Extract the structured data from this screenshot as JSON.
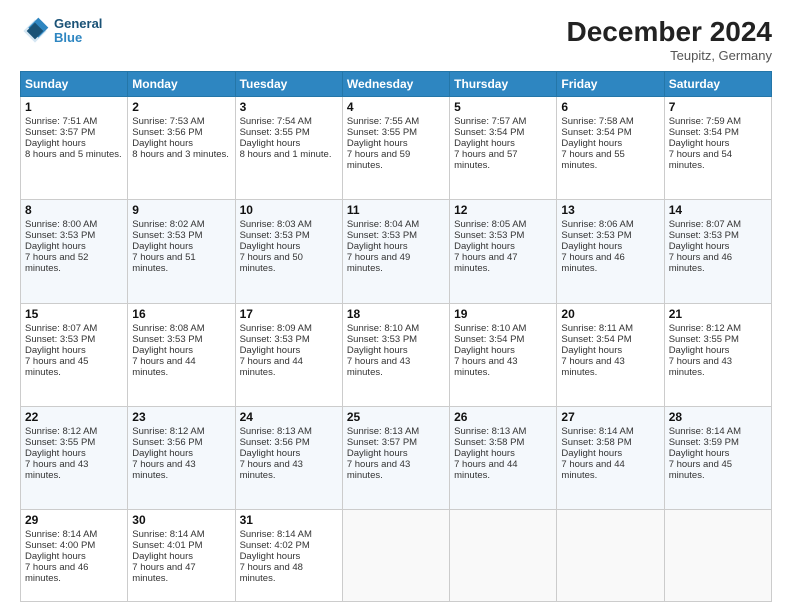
{
  "header": {
    "logo_line1": "General",
    "logo_line2": "Blue",
    "month": "December 2024",
    "location": "Teupitz, Germany"
  },
  "days_of_week": [
    "Sunday",
    "Monday",
    "Tuesday",
    "Wednesday",
    "Thursday",
    "Friday",
    "Saturday"
  ],
  "weeks": [
    [
      {
        "day": "1",
        "sunrise": "7:51 AM",
        "sunset": "3:57 PM",
        "daylight": "8 hours and 5 minutes."
      },
      {
        "day": "2",
        "sunrise": "7:53 AM",
        "sunset": "3:56 PM",
        "daylight": "8 hours and 3 minutes."
      },
      {
        "day": "3",
        "sunrise": "7:54 AM",
        "sunset": "3:55 PM",
        "daylight": "8 hours and 1 minute."
      },
      {
        "day": "4",
        "sunrise": "7:55 AM",
        "sunset": "3:55 PM",
        "daylight": "7 hours and 59 minutes."
      },
      {
        "day": "5",
        "sunrise": "7:57 AM",
        "sunset": "3:54 PM",
        "daylight": "7 hours and 57 minutes."
      },
      {
        "day": "6",
        "sunrise": "7:58 AM",
        "sunset": "3:54 PM",
        "daylight": "7 hours and 55 minutes."
      },
      {
        "day": "7",
        "sunrise": "7:59 AM",
        "sunset": "3:54 PM",
        "daylight": "7 hours and 54 minutes."
      }
    ],
    [
      {
        "day": "8",
        "sunrise": "8:00 AM",
        "sunset": "3:53 PM",
        "daylight": "7 hours and 52 minutes."
      },
      {
        "day": "9",
        "sunrise": "8:02 AM",
        "sunset": "3:53 PM",
        "daylight": "7 hours and 51 minutes."
      },
      {
        "day": "10",
        "sunrise": "8:03 AM",
        "sunset": "3:53 PM",
        "daylight": "7 hours and 50 minutes."
      },
      {
        "day": "11",
        "sunrise": "8:04 AM",
        "sunset": "3:53 PM",
        "daylight": "7 hours and 49 minutes."
      },
      {
        "day": "12",
        "sunrise": "8:05 AM",
        "sunset": "3:53 PM",
        "daylight": "7 hours and 47 minutes."
      },
      {
        "day": "13",
        "sunrise": "8:06 AM",
        "sunset": "3:53 PM",
        "daylight": "7 hours and 46 minutes."
      },
      {
        "day": "14",
        "sunrise": "8:07 AM",
        "sunset": "3:53 PM",
        "daylight": "7 hours and 46 minutes."
      }
    ],
    [
      {
        "day": "15",
        "sunrise": "8:07 AM",
        "sunset": "3:53 PM",
        "daylight": "7 hours and 45 minutes."
      },
      {
        "day": "16",
        "sunrise": "8:08 AM",
        "sunset": "3:53 PM",
        "daylight": "7 hours and 44 minutes."
      },
      {
        "day": "17",
        "sunrise": "8:09 AM",
        "sunset": "3:53 PM",
        "daylight": "7 hours and 44 minutes."
      },
      {
        "day": "18",
        "sunrise": "8:10 AM",
        "sunset": "3:53 PM",
        "daylight": "7 hours and 43 minutes."
      },
      {
        "day": "19",
        "sunrise": "8:10 AM",
        "sunset": "3:54 PM",
        "daylight": "7 hours and 43 minutes."
      },
      {
        "day": "20",
        "sunrise": "8:11 AM",
        "sunset": "3:54 PM",
        "daylight": "7 hours and 43 minutes."
      },
      {
        "day": "21",
        "sunrise": "8:12 AM",
        "sunset": "3:55 PM",
        "daylight": "7 hours and 43 minutes."
      }
    ],
    [
      {
        "day": "22",
        "sunrise": "8:12 AM",
        "sunset": "3:55 PM",
        "daylight": "7 hours and 43 minutes."
      },
      {
        "day": "23",
        "sunrise": "8:12 AM",
        "sunset": "3:56 PM",
        "daylight": "7 hours and 43 minutes."
      },
      {
        "day": "24",
        "sunrise": "8:13 AM",
        "sunset": "3:56 PM",
        "daylight": "7 hours and 43 minutes."
      },
      {
        "day": "25",
        "sunrise": "8:13 AM",
        "sunset": "3:57 PM",
        "daylight": "7 hours and 43 minutes."
      },
      {
        "day": "26",
        "sunrise": "8:13 AM",
        "sunset": "3:58 PM",
        "daylight": "7 hours and 44 minutes."
      },
      {
        "day": "27",
        "sunrise": "8:14 AM",
        "sunset": "3:58 PM",
        "daylight": "7 hours and 44 minutes."
      },
      {
        "day": "28",
        "sunrise": "8:14 AM",
        "sunset": "3:59 PM",
        "daylight": "7 hours and 45 minutes."
      }
    ],
    [
      {
        "day": "29",
        "sunrise": "8:14 AM",
        "sunset": "4:00 PM",
        "daylight": "7 hours and 46 minutes."
      },
      {
        "day": "30",
        "sunrise": "8:14 AM",
        "sunset": "4:01 PM",
        "daylight": "7 hours and 47 minutes."
      },
      {
        "day": "31",
        "sunrise": "8:14 AM",
        "sunset": "4:02 PM",
        "daylight": "7 hours and 48 minutes."
      },
      null,
      null,
      null,
      null
    ]
  ]
}
